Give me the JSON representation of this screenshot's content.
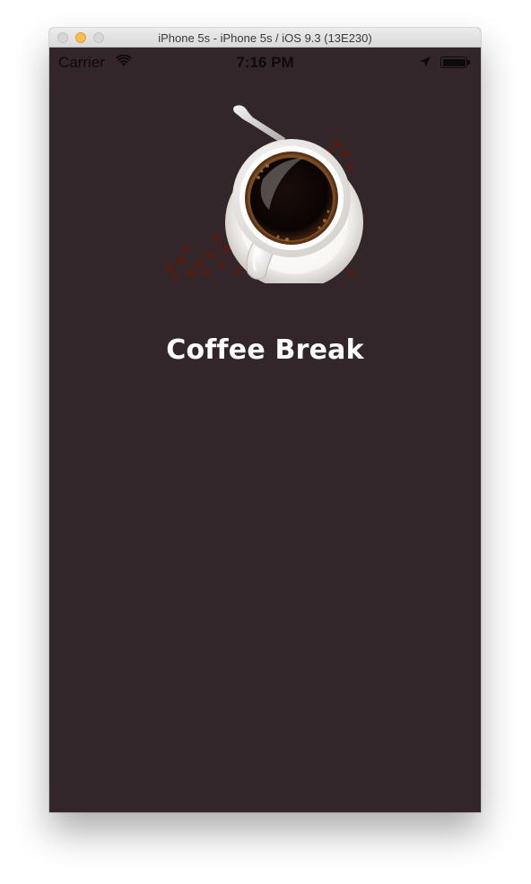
{
  "window": {
    "title": "iPhone 5s - iPhone 5s / iOS 9.3 (13E230)"
  },
  "status_bar": {
    "carrier": "Carrier",
    "time": "7:16 PM",
    "icons": [
      "wifi-icon",
      "location-arrow-icon",
      "battery-icon"
    ],
    "battery_level": 1.0
  },
  "app": {
    "title": "Coffee Break",
    "hero_image": "coffee-cup-with-beans",
    "background_color": "#33262a",
    "title_color": "#ffffff"
  }
}
